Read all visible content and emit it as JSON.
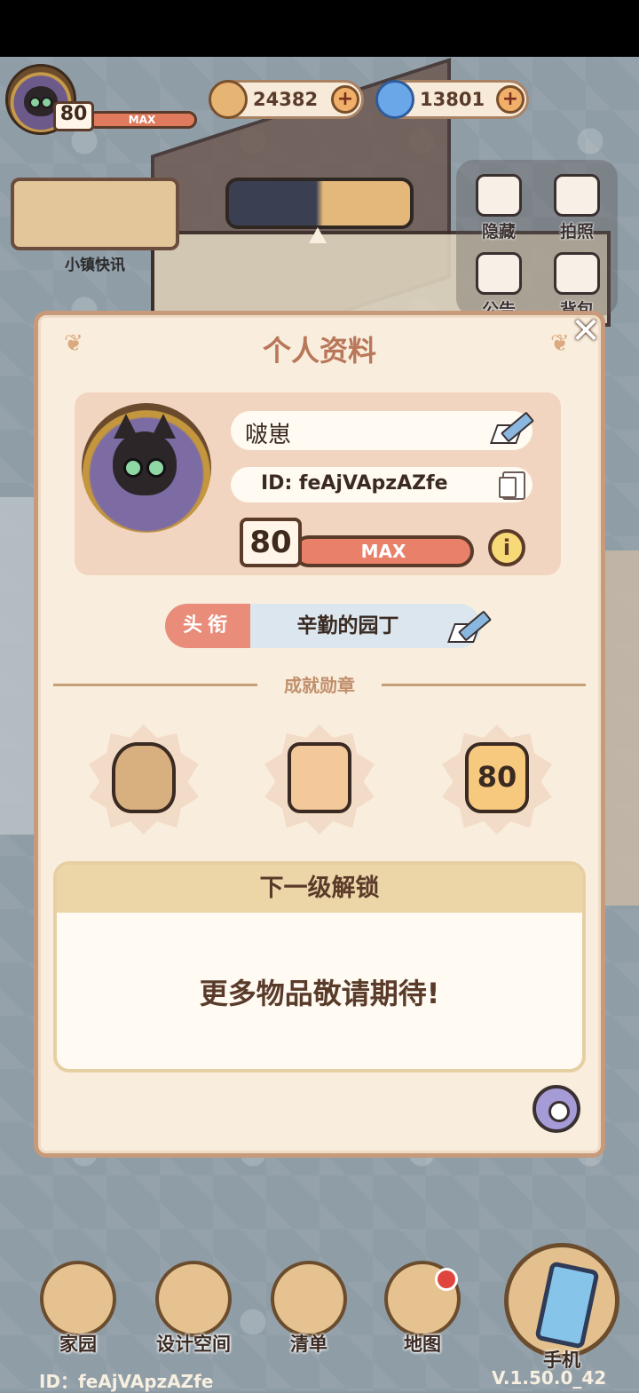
{
  "top_hud": {
    "level": "80",
    "level_bar": "MAX",
    "coins": "24382",
    "gems": "13801",
    "plus": "+"
  },
  "news": {
    "label": "小镇快讯"
  },
  "side_menu": {
    "hide": "隐藏",
    "photo": "拍照",
    "notice": "公告",
    "bag": "背包"
  },
  "dialog": {
    "title": "个人资料",
    "close": "✕",
    "name": "啵崽",
    "id": "ID: feAjVApzAZfe",
    "level": "80",
    "level_bar": "MAX",
    "info": "i",
    "title_tag": "头衔",
    "title_value": "辛勤的园丁",
    "achievements_label": "成就勋章",
    "medal_level": "80",
    "unlock_header": "下一级解锁",
    "unlock_body": "更多物品敬请期待!"
  },
  "nav": {
    "home": "家园",
    "design": "设计空间",
    "list": "清单",
    "map": "地图",
    "phone": "手机"
  },
  "footer": {
    "id": "ID：feAjVApzAZfe",
    "version": "V.1.50.0_42"
  },
  "colors": {
    "accent": "#b9775a",
    "dialog_bg": "#f9eedd",
    "level_bar": "#e9806a",
    "title_tag": "#e98c7a"
  }
}
